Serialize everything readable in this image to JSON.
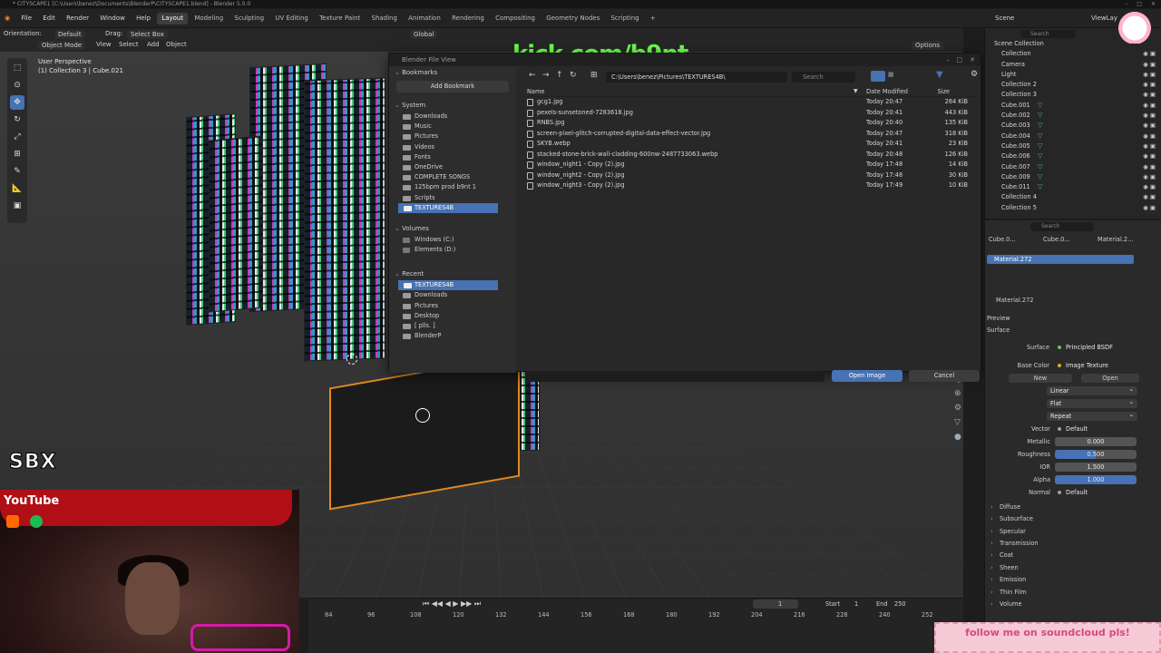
{
  "window": {
    "title": "* CITYSCAPE1 [C:\\Users\\benez\\Documents\\BlenderP\\CITYSCAPE1.blend] - Blender 5.0.0"
  },
  "menubar": {
    "menus": [
      "File",
      "Edit",
      "Render",
      "Window",
      "Help"
    ],
    "workspaces": [
      "Layout",
      "Modeling",
      "Sculpting",
      "UV Editing",
      "Texture Paint",
      "Shading",
      "Animation",
      "Rendering",
      "Compositing",
      "Geometry Nodes",
      "Scripting"
    ],
    "active_workspace": "Layout",
    "plus": "+",
    "scene_label": "Scene",
    "view_layer_label": "ViewLay"
  },
  "header": {
    "orientation_label": "Orientation:",
    "orientation_value": "Default",
    "drag_label": "Drag:",
    "drag_value": "Select Box",
    "mode": "Object Mode",
    "menus": [
      "View",
      "Select",
      "Add",
      "Object"
    ],
    "transform_orientation": "Global",
    "options": "Options"
  },
  "viewport": {
    "perspective": "User Perspective",
    "collection_info": "(1) Collection 3 | Cube.021"
  },
  "overlay": {
    "kick": "kick.com/b9nt",
    "sbx": "SBX",
    "youtube": "YouTube",
    "soundcloud": "follow me on soundcloud pls!"
  },
  "file_browser": {
    "title": "Blender File View",
    "path": "C:\\Users\\benez\\Pictures\\TEXTURES4B\\",
    "search_placeholder": "Search",
    "bookmarks_label": "Bookmarks",
    "add_bookmark": "Add Bookmark",
    "system_label": "System",
    "system_items": [
      "Downloads",
      "Music",
      "Pictures",
      "Videos",
      "Fonts",
      "OneDrive",
      "COMPLETE SONGS",
      "125bpm prod b9nt 1",
      "Scripts",
      "TEXTURES4B"
    ],
    "system_selected": "TEXTURES4B",
    "volumes_label": "Volumes",
    "volumes": [
      "Windows (C:)",
      "Elements (D:)"
    ],
    "recent_label": "Recent",
    "recent_items": [
      "TEXTURES4B",
      "Downloads",
      "Pictures",
      "Desktop",
      "[ plls. ]",
      "BlenderP"
    ],
    "columns": {
      "name": "Name",
      "date": "Date Modified",
      "size": "Size"
    },
    "files": [
      {
        "name": "gcg1.jpg",
        "date": "Today 20:47",
        "size": "264 KiB"
      },
      {
        "name": "pexels-sunsetoned-7283618.jpg",
        "date": "Today 20:41",
        "size": "443 KiB"
      },
      {
        "name": "RNBS.jpg",
        "date": "Today 20:40",
        "size": "135 KiB"
      },
      {
        "name": "screen-pixel-glitch-corrupted-digital-data-effect-vector.jpg",
        "date": "Today 20:47",
        "size": "318 KiB"
      },
      {
        "name": "SKYB.webp",
        "date": "Today 20:41",
        "size": "23 KiB"
      },
      {
        "name": "stacked-stone-brick-wall-cladding-600nw-2487733063.webp",
        "date": "Today 20:48",
        "size": "126 KiB"
      },
      {
        "name": "window_night1 - Copy (2).jpg",
        "date": "Today 17:48",
        "size": "14 KiB"
      },
      {
        "name": "window_night2 - Copy (2).jpg",
        "date": "Today 17:48",
        "size": "30 KiB"
      },
      {
        "name": "window_night3 - Copy (2).jpg",
        "date": "Today 17:49",
        "size": "10 KiB"
      }
    ],
    "open_button": "Open Image",
    "cancel_button": "Cancel"
  },
  "outliner": {
    "search_placeholder": "Search",
    "root": "Scene Collection",
    "rows": [
      "Collection",
      "Camera",
      "Light",
      "Collection 2",
      "Collection 3",
      "Cube.001",
      "Cube.002",
      "Cube.003",
      "Cube.004",
      "Cube.005",
      "Cube.006",
      "Cube.007",
      "Cube.009",
      "Cube.011",
      "Collection 4",
      "Collection 5"
    ]
  },
  "properties": {
    "search_placeholder": "Search",
    "breadcrumb": [
      "Cube.0...",
      "Cube.0...",
      "Material.2..."
    ],
    "material_slot": "Material.272",
    "material_name": "Material.272",
    "preview": "Preview",
    "surface_section": "Surface",
    "surface_label": "Surface",
    "surface_value": "Principled BSDF",
    "base_color_label": "Base Color",
    "base_color_value": "Image Texture",
    "new_btn": "New",
    "open_btn": "Open",
    "interpolation": "Linear",
    "projection": "Flat",
    "extension": "Repeat",
    "vector_label": "Vector",
    "vector_value": "Default",
    "metallic_label": "Metallic",
    "metallic_value": "0.000",
    "roughness_label": "Roughness",
    "roughness_value": "0.500",
    "ior_label": "IOR",
    "ior_value": "1.500",
    "alpha_label": "Alpha",
    "alpha_value": "1.000",
    "normal_label": "Normal",
    "normal_value": "Default",
    "sections": [
      "Diffuse",
      "Subsurface",
      "Specular",
      "Transmission",
      "Coat",
      "Sheen",
      "Emission",
      "Thin Film",
      "Volume"
    ]
  },
  "timeline": {
    "frame": "1",
    "start_label": "Start",
    "start_value": "1",
    "end_label": "End",
    "end_value": "250",
    "ticks": [
      "84",
      "96",
      "108",
      "120",
      "132",
      "144",
      "156",
      "168",
      "180",
      "192",
      "204",
      "216",
      "228",
      "240",
      "252"
    ]
  }
}
